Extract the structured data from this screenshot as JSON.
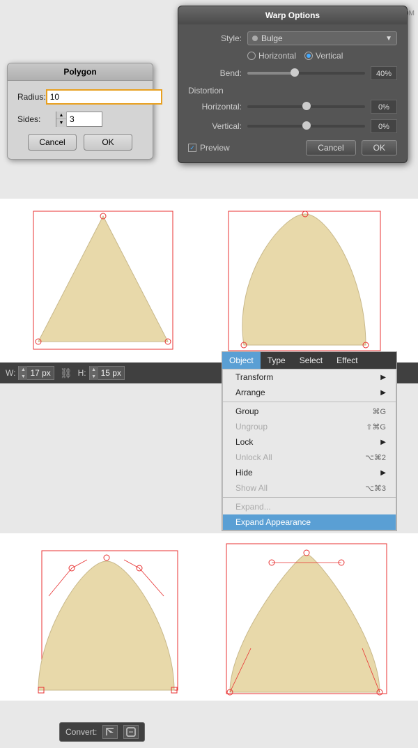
{
  "watermark": "思绪设计论坛 www.MISSVUAN.COM",
  "polygon_dialog": {
    "title": "Polygon",
    "radius_label": "Radius:",
    "radius_value": "10",
    "sides_label": "Sides:",
    "sides_value": "3",
    "cancel_label": "Cancel",
    "ok_label": "OK"
  },
  "warp_dialog": {
    "title": "Warp Options",
    "style_label": "Style:",
    "style_value": "Bulge",
    "horizontal_label": "Horizontal",
    "vertical_label": "Vertical",
    "bend_label": "Bend:",
    "bend_value": "40%",
    "bend_percent": 40,
    "distortion_label": "Distortion",
    "horiz_label": "Horizontal:",
    "horiz_value": "0%",
    "vert_label": "Vertical:",
    "vert_value": "0%",
    "preview_label": "Preview",
    "cancel_label": "Cancel",
    "ok_label": "OK"
  },
  "toolbar": {
    "w_label": "W:",
    "w_value": "17 px",
    "h_label": "H:",
    "h_value": "15 px"
  },
  "menu": {
    "object_label": "Object",
    "type_label": "Type",
    "select_label": "Select",
    "effect_label": "Effect",
    "items": [
      {
        "label": "Transform",
        "shortcut": "",
        "has_arrow": true,
        "disabled": false
      },
      {
        "label": "Arrange",
        "shortcut": "",
        "has_arrow": true,
        "disabled": false
      },
      {
        "separator": true
      },
      {
        "label": "Group",
        "shortcut": "⌘G",
        "has_arrow": false,
        "disabled": false
      },
      {
        "label": "Ungroup",
        "shortcut": "⇧⌘G",
        "has_arrow": false,
        "disabled": true
      },
      {
        "label": "Lock",
        "shortcut": "",
        "has_arrow": true,
        "disabled": false
      },
      {
        "label": "Unlock All",
        "shortcut": "⌥⌘2",
        "has_arrow": false,
        "disabled": true
      },
      {
        "label": "Hide",
        "shortcut": "",
        "has_arrow": true,
        "disabled": false
      },
      {
        "label": "Show All",
        "shortcut": "⌥⌘3",
        "has_arrow": false,
        "disabled": true
      },
      {
        "separator": true
      },
      {
        "label": "Expand...",
        "shortcut": "",
        "has_arrow": false,
        "disabled": true
      },
      {
        "label": "Expand Appearance",
        "shortcut": "",
        "has_arrow": false,
        "disabled": false,
        "highlighted": true
      }
    ]
  },
  "convert_toolbar": {
    "label": "Convert:"
  }
}
